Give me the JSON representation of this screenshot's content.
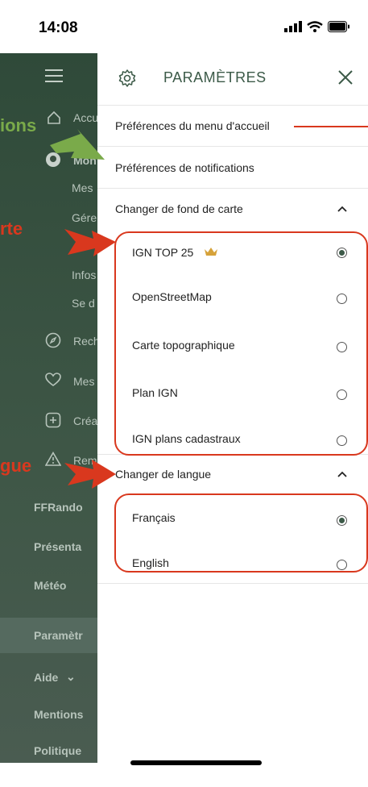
{
  "status_bar": {
    "time": "14:08"
  },
  "drawer": {
    "items": [
      "Accu",
      "Mon",
      "Mes",
      "Gére",
      "Infos",
      "Se d",
      "Rech",
      "Mes",
      "Créa",
      "Rem"
    ],
    "links": [
      "FFRando",
      "Présenta",
      "Météo",
      "Paramètr",
      "Aide",
      "Mentions",
      "Politique"
    ]
  },
  "panel": {
    "title": "PARAMÈTRES",
    "home_prefs": "Préférences du menu d'accueil",
    "notif_prefs": "Préférences de notifications",
    "basemap_section": "Changer de fond de carte",
    "basemaps": [
      "IGN TOP 25",
      "OpenStreetMap",
      "Carte topographique",
      "Plan IGN",
      "IGN plans cadastraux"
    ],
    "language_section": "Changer de langue",
    "languages": [
      "Français",
      "English"
    ]
  },
  "annotations": {
    "a1": "ions",
    "a2": "rte",
    "a3": "gue"
  },
  "colors": {
    "accent": "#3c5a48",
    "red": "#d9381e",
    "green_arrow": "#7aaa4a",
    "crown": "#d6a23a"
  }
}
